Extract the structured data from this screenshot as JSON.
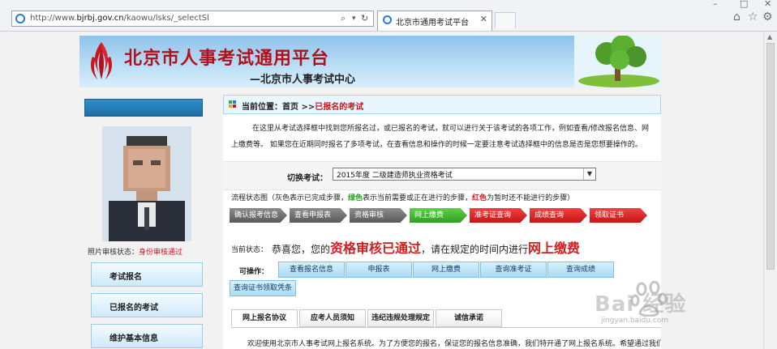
{
  "browser": {
    "url_prefix": "http://www.",
    "url_domain": "bjrbj.gov.cn",
    "url_path": "/kaowu/lsks/_selectSl",
    "tab_title": "北京市通用考试平台"
  },
  "banner": {
    "title": "北京市人事考试通用平台",
    "subtitle": "—北京市人事考试中心"
  },
  "sidebar": {
    "photo_caption_label": "照片审核状态：",
    "photo_caption_status": "身份审核通过",
    "items": [
      {
        "label": "考试报名"
      },
      {
        "label": "已报名的考试"
      },
      {
        "label": "维护基本信息"
      }
    ]
  },
  "breadcrumb": {
    "prefix": "当前位置：首页 >>",
    "current": "已报名的考试"
  },
  "intro": "在这里从考试选择框中找到您所报名过，或已报名的考试，就可以进行关于该考试的各项工作，例如查看/修改报名信息、网上缴费等。 如果您在近期同时报名了多项考试，在查看信息和操作的时候一定要注意考试选择框中的信息是否是您想要操作的。",
  "exam_switch": {
    "label": "切换考试：",
    "selected": "2015年度 二级建造师执业资格考试"
  },
  "flow": {
    "legend_a": "流程状态图（灰色表示已完成步骤，",
    "legend_green": "绿色",
    "legend_b": "表示当前需要或正在进行的步骤，",
    "legend_red": "红色",
    "legend_c": "为暂时还不能进行的步骤）",
    "steps": [
      {
        "label": "确认报考信息",
        "state": "done"
      },
      {
        "label": "查看申报表",
        "state": "done"
      },
      {
        "label": "资格审核",
        "state": "done"
      },
      {
        "label": "网上缴费",
        "state": "current"
      },
      {
        "label": "准考证查询",
        "state": "todo"
      },
      {
        "label": "成绩查询",
        "state": "todo"
      },
      {
        "label": "领取证书",
        "state": "todo"
      }
    ]
  },
  "status": {
    "label": "当前状态：",
    "part1": "恭喜您，您的",
    "highlight1": "资格审核已通过",
    "part2": "，请在规定的时间内进行",
    "highlight2": "网上缴费"
  },
  "operations": {
    "label": "可操作：",
    "buttons": [
      {
        "label": "查看报名信息"
      },
      {
        "label": "申报表"
      },
      {
        "label": "网上缴费"
      },
      {
        "label": "查询准考证"
      },
      {
        "label": "查询成绩"
      },
      {
        "label": "查询证书领取凭条"
      }
    ]
  },
  "info_tabs": [
    {
      "label": "网上报名协议"
    },
    {
      "label": "应考人员须知"
    },
    {
      "label": "违纪违规处理规定"
    },
    {
      "label": "诚信承诺"
    }
  ],
  "welcome": "欢迎使用北京市人事考试网上报名系统。为了方便您的报名，保证您的报名信息准确，我们特开通了网上报名系统。希望通过我们",
  "watermark": {
    "brand": "Bai 经验",
    "url": "jingyan.baidu.com"
  },
  "colors": {
    "accent_red": "#c8181e",
    "step_done": "#6e6e6e",
    "step_current": "#3aae2b",
    "step_todo": "#d51b1b",
    "button_blue": "#a9dbf4"
  }
}
